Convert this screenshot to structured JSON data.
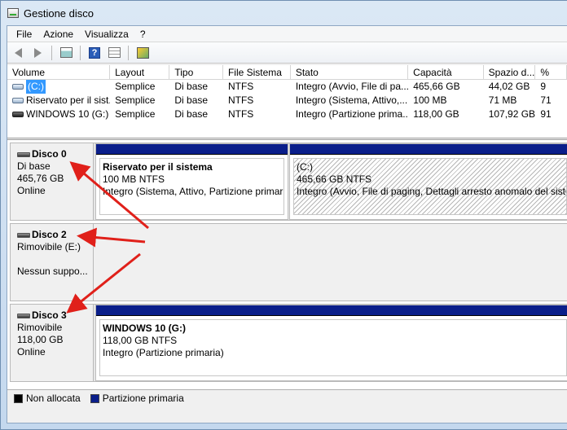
{
  "window": {
    "title": "Gestione disco"
  },
  "menu": [
    "File",
    "Azione",
    "Visualizza",
    "?"
  ],
  "toolbar": {
    "icons": [
      "back-arrow-icon",
      "forward-arrow-icon",
      "properties-icon",
      "help-icon",
      "list-view-icon",
      "check-icon"
    ]
  },
  "volume_table": {
    "columns": [
      "Volume",
      "Layout",
      "Tipo",
      "File Sistema",
      "Stato",
      "Capacità",
      "Spazio d...",
      "%"
    ],
    "rows": [
      {
        "volume": "(C:)",
        "layout": "Semplice",
        "tipo": "Di base",
        "fs": "NTFS",
        "stato": "Integro (Avvio, File di pa...",
        "capacita": "465,66 GB",
        "spazio": "44,02 GB",
        "pct": "9"
      },
      {
        "volume": "Riservato per il sist...",
        "layout": "Semplice",
        "tipo": "Di base",
        "fs": "NTFS",
        "stato": "Integro (Sistema, Attivo,...",
        "capacita": "100 MB",
        "spazio": "71 MB",
        "pct": "71"
      },
      {
        "volume": "WINDOWS 10 (G:)",
        "layout": "Semplice",
        "tipo": "Di base",
        "fs": "NTFS",
        "stato": "Integro (Partizione prima...",
        "capacita": "118,00 GB",
        "spazio": "107,92 GB",
        "pct": "91"
      }
    ]
  },
  "disks": [
    {
      "name": "Disco 0",
      "line1": "Di base",
      "line2": "465,76 GB",
      "line3": "Online",
      "partitions": [
        {
          "name": "Riservato per il sistema",
          "size": "100 MB NTFS",
          "status": "Integro (Sistema, Attivo, Partizione primari"
        },
        {
          "name": "(C:)",
          "size": "465,66 GB NTFS",
          "status": "Integro (Avvio, File di paging, Dettagli arresto anomalo del sistem"
        }
      ]
    },
    {
      "name": "Disco 2",
      "line1": "Rimovibile (E:)",
      "line2": "",
      "line3": "Nessun suppo..."
    },
    {
      "name": "Disco 3",
      "line1": "Rimovibile",
      "line2": "118,00 GB",
      "line3": "Online",
      "partitions": [
        {
          "name": "WINDOWS 10  (G:)",
          "size": "118,00 GB NTFS",
          "status": "Integro (Partizione primaria)"
        }
      ]
    }
  ],
  "legend": [
    {
      "label": "Non allocata",
      "color": "#000000"
    },
    {
      "label": "Partizione primaria",
      "color": "#0a1e8a"
    }
  ],
  "annotation_color": "#e0201a"
}
